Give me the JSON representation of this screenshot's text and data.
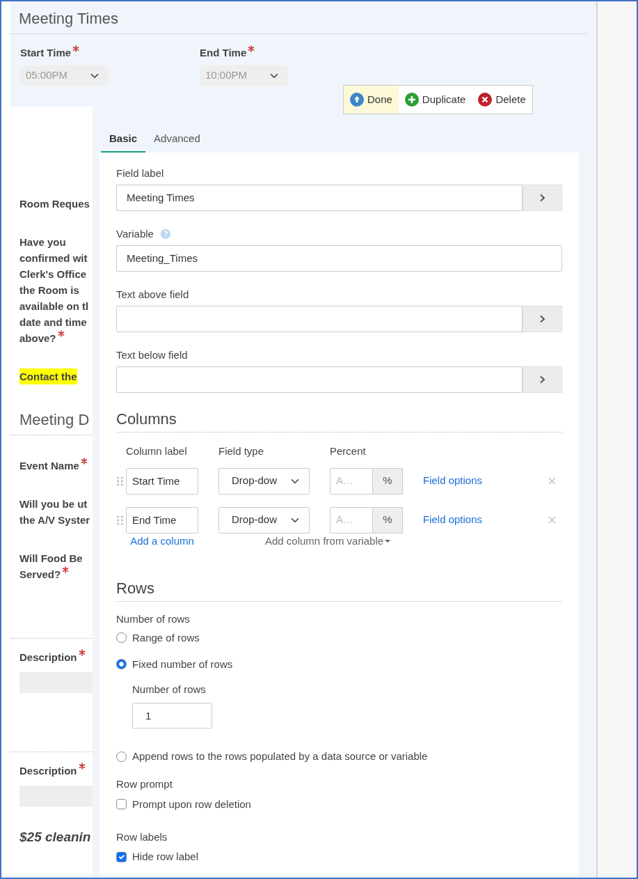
{
  "section_title": "Meeting Times",
  "time_fields": [
    {
      "label": "Start Time",
      "required": true,
      "value": "05:00PM",
      "disabled": true
    },
    {
      "label": "End Time",
      "required": true,
      "value": "10:00PM",
      "disabled": true
    }
  ],
  "actions": [
    {
      "label": "Done",
      "kind": "done",
      "highlighted": true
    },
    {
      "label": "Duplicate",
      "kind": "duplicate",
      "highlighted": false
    },
    {
      "label": "Delete",
      "kind": "delete",
      "highlighted": false
    }
  ],
  "background_form": [
    {
      "kind": "label",
      "lines": [
        "Room Reques"
      ],
      "required": false
    },
    {
      "kind": "label",
      "lines": [
        "Have you",
        "confirmed wit",
        "Clerk's Office",
        "the Room is",
        "available on tl",
        "date and time",
        "above?"
      ],
      "required": true
    },
    {
      "kind": "highlight",
      "lines": [
        "Contact the"
      ],
      "required": false
    },
    {
      "kind": "heading",
      "lines": [
        "Meeting D"
      ],
      "required": false
    },
    {
      "kind": "label",
      "lines": [
        "Event Name"
      ],
      "required": true
    },
    {
      "kind": "label",
      "lines": [
        "Will you be ut",
        "the A/V Syster"
      ],
      "required": false
    },
    {
      "kind": "label",
      "lines": [
        "Will Food Be",
        "Served?"
      ],
      "required": true
    },
    {
      "kind": "field",
      "lines": [
        "Description"
      ],
      "required": true
    },
    {
      "kind": "field",
      "lines": [
        "Description"
      ],
      "required": true
    },
    {
      "kind": "note",
      "lines": [
        "$25 cleanin"
      ],
      "required": false
    }
  ],
  "editor": {
    "tabs": [
      {
        "label": "Basic",
        "selected": true
      },
      {
        "label": "Advanced",
        "selected": false
      }
    ],
    "fields": [
      {
        "label": "Field label",
        "value": "Meeting Times",
        "help": false,
        "expand_button": true
      },
      {
        "label": "Variable",
        "value": "Meeting_Times",
        "help": true,
        "expand_button": false
      },
      {
        "label": "Text above field",
        "help": false,
        "expand_button": true
      },
      {
        "label": "Text below field",
        "help": false,
        "expand_button": true
      }
    ],
    "columns": {
      "title": "Columns",
      "headers": [
        "Column label",
        "Field type",
        "Percent"
      ],
      "rows": [
        {
          "label": "Start Time",
          "field_type": "Drop-dow",
          "percent_placeholder": "A…",
          "unit": "%",
          "options_link": "Field options"
        },
        {
          "label": "End Time",
          "field_type": "Drop-dow",
          "percent_placeholder": "A…",
          "unit": "%",
          "options_link": "Field options"
        }
      ],
      "add_link": "Add a column",
      "add_from_variable": "Add column from variable"
    },
    "rows": {
      "title": "Rows",
      "number_label": "Number of rows",
      "options": [
        {
          "label": "Range of rows",
          "selected": false
        },
        {
          "label": "Fixed number of rows",
          "selected": true
        },
        {
          "label": "Append rows to the rows populated by a data source or variable",
          "selected": false
        }
      ],
      "count_field": {
        "label": "Number of rows",
        "value": "1"
      },
      "groups": [
        {
          "label": "Row prompt",
          "option": "Prompt upon row deletion",
          "checked": false
        },
        {
          "label": "Row labels",
          "option": "Hide row label",
          "checked": true
        }
      ]
    }
  }
}
